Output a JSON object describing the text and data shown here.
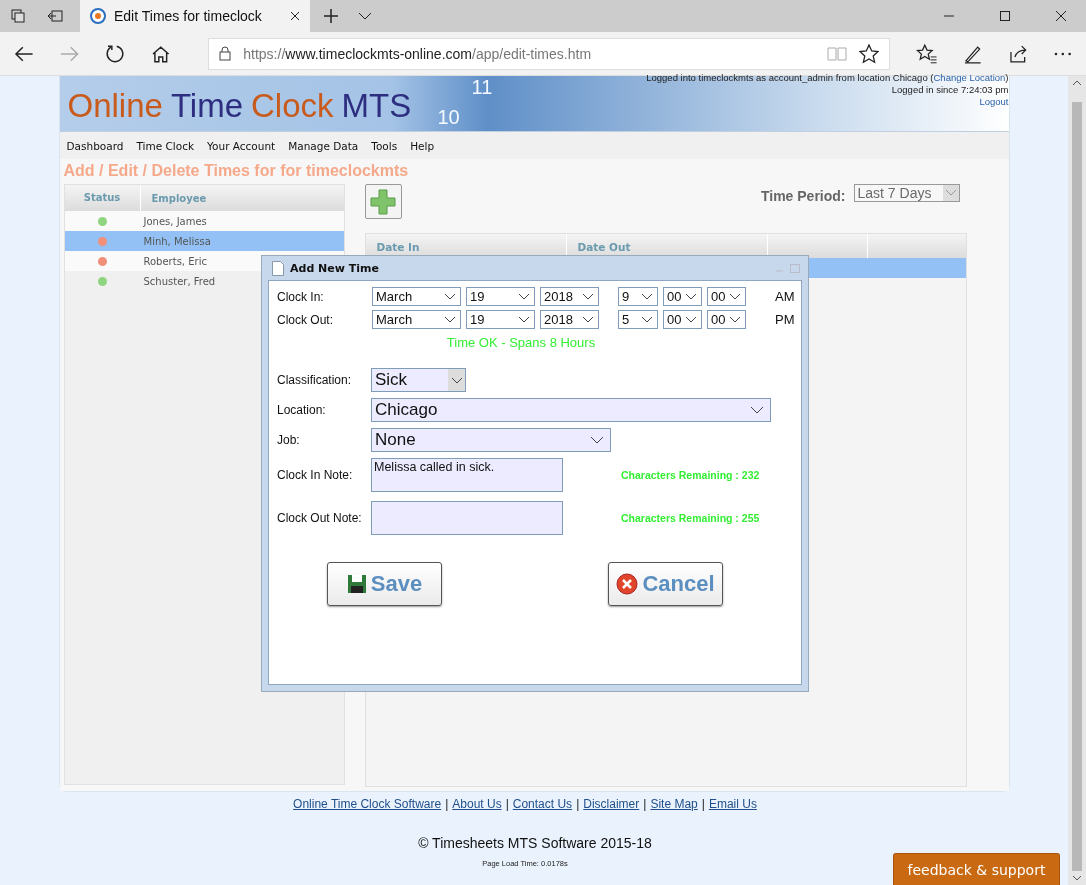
{
  "browser": {
    "tab_title": "Edit Times for timeclock",
    "address": {
      "scheme": "https://",
      "domain": "www.timeclockmts-online.com",
      "path": "/app/edit-times.htm"
    }
  },
  "header": {
    "logo": [
      {
        "text": "Online",
        "kind": "accent"
      },
      {
        "text": "Time",
        "kind": "plain"
      },
      {
        "text": "Clock",
        "kind": "accent"
      },
      {
        "text": "MTS",
        "kind": "plain"
      }
    ],
    "clock_numerals": [
      "11",
      "10"
    ],
    "login_text": "Logged into timeclockmts as account_admin from location Chicago (",
    "change_location_link": "Change Location",
    "login_text_end": ")",
    "since": "Logged in since 7:24:03 pm",
    "logout_link": "Logout"
  },
  "nav": [
    "Dashboard",
    "Time Clock",
    "Your Account",
    "Manage Data",
    "Tools",
    "Help"
  ],
  "page_title": "Add / Edit / Delete Times for for timeclockmts",
  "employee_table": {
    "columns": [
      "Status",
      "Employee"
    ],
    "rows": [
      {
        "color": "#8fd47e",
        "name": "Jones, James",
        "selected": false
      },
      {
        "color": "#f0907a",
        "name": "Minh, Melissa",
        "selected": true
      },
      {
        "color": "#f0907a",
        "name": "Roberts, Eric",
        "selected": false
      },
      {
        "color": "#8fd47e",
        "name": "Schuster, Fred",
        "selected": false
      }
    ]
  },
  "time_period": {
    "label": "Time Period:",
    "value": "Last 7 Days"
  },
  "times_table": {
    "columns": [
      "Date In",
      "Date Out"
    ],
    "rows": [
      {
        "selected": true
      }
    ]
  },
  "dialog": {
    "title": "Add New Time",
    "clock_rows": [
      {
        "label": "Clock In:",
        "month": "March",
        "day": "19",
        "year": "2018",
        "hour": "9",
        "minute": "00",
        "second": "00",
        "meridiem": "AM"
      },
      {
        "label": "Clock Out:",
        "month": "March",
        "day": "19",
        "year": "2018",
        "hour": "5",
        "minute": "00",
        "second": "00",
        "meridiem": "PM"
      }
    ],
    "status": "Time OK - Spans 8 Hours",
    "classification": {
      "label": "Classification:",
      "value": "Sick"
    },
    "location": {
      "label": "Location:",
      "value": "Chicago"
    },
    "job": {
      "label": "Job:",
      "value": "None"
    },
    "notes": [
      {
        "label": "Clock In Note:",
        "value": "Melissa called in sick.",
        "remaining": "Characters Remaining : 232"
      },
      {
        "label": "Clock Out Note:",
        "remaining": "Characters Remaining : 255"
      }
    ],
    "buttons": [
      {
        "label": "Save",
        "kind": "save"
      },
      {
        "label": "Cancel",
        "kind": "cancel"
      }
    ]
  },
  "footer": {
    "links": [
      "Online Time Clock Software",
      "About Us",
      "Contact Us",
      "Disclaimer",
      "Site Map",
      "Email Us"
    ],
    "separator": "|",
    "copyright": "© Timesheets MTS Software 2015-18",
    "load_time": "Page Load Time: 0.0178s",
    "feedback_button": "feedback & support"
  }
}
